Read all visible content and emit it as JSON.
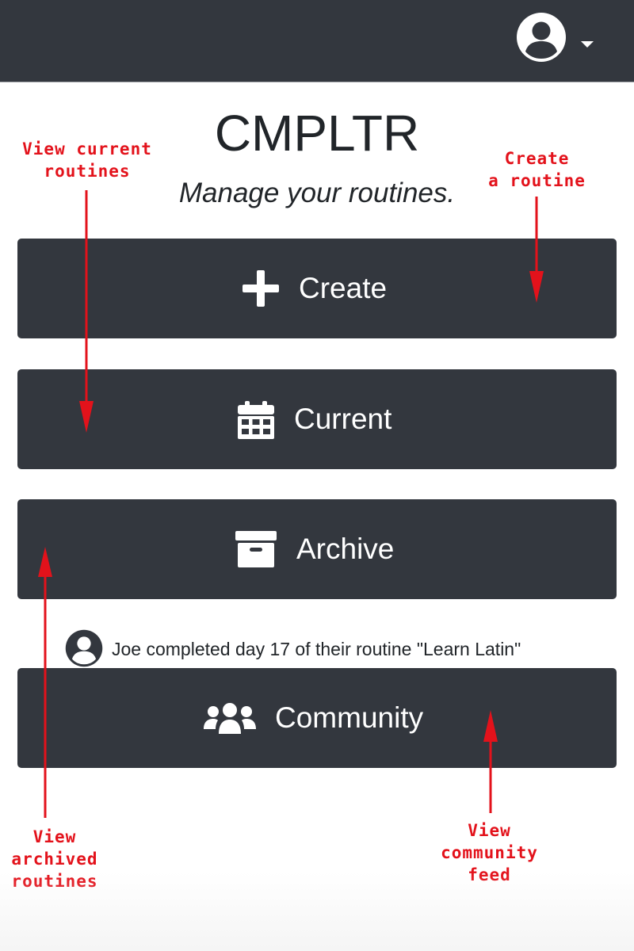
{
  "app": {
    "title": "CMPLTR",
    "subtitle": "Manage your routines."
  },
  "navbar": {
    "user_icon": "user-circle-icon",
    "menu_icon": "caret-down-icon"
  },
  "buttons": [
    {
      "label": "Create",
      "icon": "plus-icon"
    },
    {
      "label": "Current",
      "icon": "calendar-icon"
    },
    {
      "label": "Archive",
      "icon": "archive-box-icon"
    },
    {
      "label": "Community",
      "icon": "users-icon"
    }
  ],
  "feed": {
    "icon": "user-circle-icon",
    "text": "Joe completed day 17 of their routine \"Learn Latin\""
  },
  "annotations": {
    "current": [
      "View current",
      "routines"
    ],
    "create": [
      "Create",
      "a routine"
    ],
    "archive": [
      "View",
      "archived",
      "routines"
    ],
    "community": [
      "View",
      "community",
      "feed"
    ]
  },
  "colors": {
    "dark": "#33373e",
    "text": "#212529",
    "annotation": "#e3121b",
    "white": "#ffffff"
  }
}
